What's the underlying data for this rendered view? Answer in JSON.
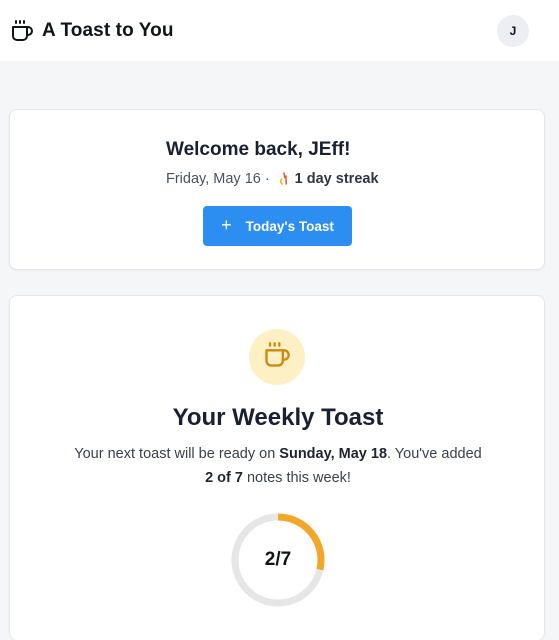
{
  "header": {
    "brand_icon": "coffee-cup-icon",
    "title": "A Toast to You",
    "avatar_initial": "J"
  },
  "welcome": {
    "title": "Welcome back, JEff!",
    "date": "Friday, May 16",
    "separator": "·",
    "streak_icon": "flame-icon",
    "streak": "1 day streak",
    "button_label": "Today's Toast",
    "button_icon": "plus-icon"
  },
  "weekly": {
    "icon": "coffee-cup-icon",
    "title": "Your Weekly Toast",
    "desc_prefix": "Your next toast will be ready on ",
    "ready_date": "Sunday, May 18",
    "desc_middle": ". You've added ",
    "notes_count": "2 of 7",
    "desc_suffix": " notes this week!",
    "progress_label": "2/7",
    "progress_fraction": 0.2857
  },
  "colors": {
    "accent": "#2b8ef0",
    "progress": "#f2a62a",
    "track": "#e6e6e6",
    "cup": "#c98a0e",
    "cup_bg": "#fdf0c4"
  }
}
